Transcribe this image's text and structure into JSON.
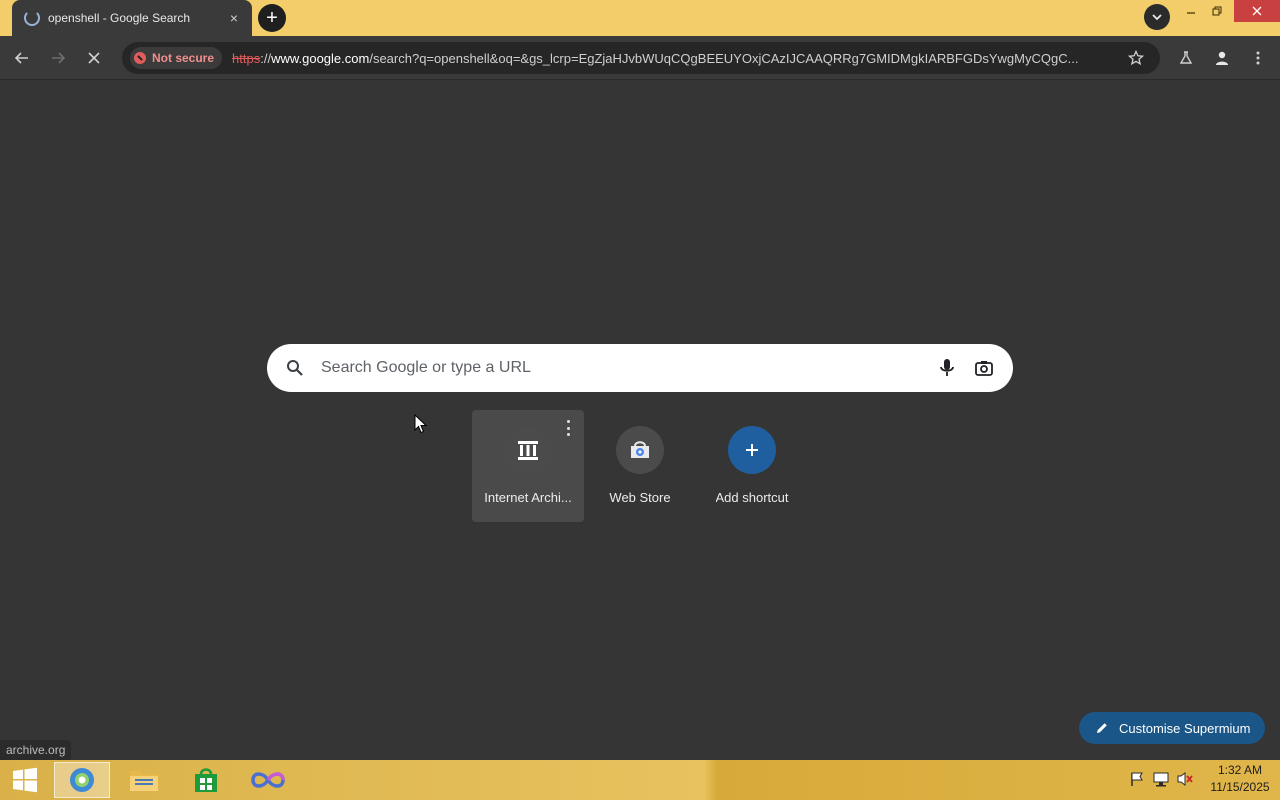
{
  "tab": {
    "title": "openshell - Google Search",
    "close_label": "×"
  },
  "tabstrip": {
    "new_tab_label": "+"
  },
  "toolbar": {
    "security_label": "Not secure",
    "url_scheme": "https",
    "url_sep": "://",
    "url_host": "www.google.com",
    "url_rest": "/search?q=openshell&oq=&gs_lcrp=EgZjaHJvbWUqCQgBEEUYOxjCAzIJCAAQRRg7GMIDMgkIARBFGDsYwgMyCQgC..."
  },
  "search": {
    "placeholder": "Search Google or type a URL"
  },
  "shortcuts": [
    {
      "label": "Internet Archi...",
      "icon": "archive-icon"
    },
    {
      "label": "Web Store",
      "icon": "web-store-icon"
    },
    {
      "label": "Add shortcut",
      "icon": "plus-icon"
    }
  ],
  "customise": {
    "label": "Customise Supermium"
  },
  "status": {
    "text": "archive.org"
  },
  "clock": {
    "time": "1:32 AM",
    "date": "11/15/2025"
  },
  "colors": {
    "tabstrip": "#f2cd6a",
    "toolbar": "#3a3a3a",
    "page_bg": "#353535",
    "accent": "#1a5688",
    "insecure": "#e25c5c"
  }
}
